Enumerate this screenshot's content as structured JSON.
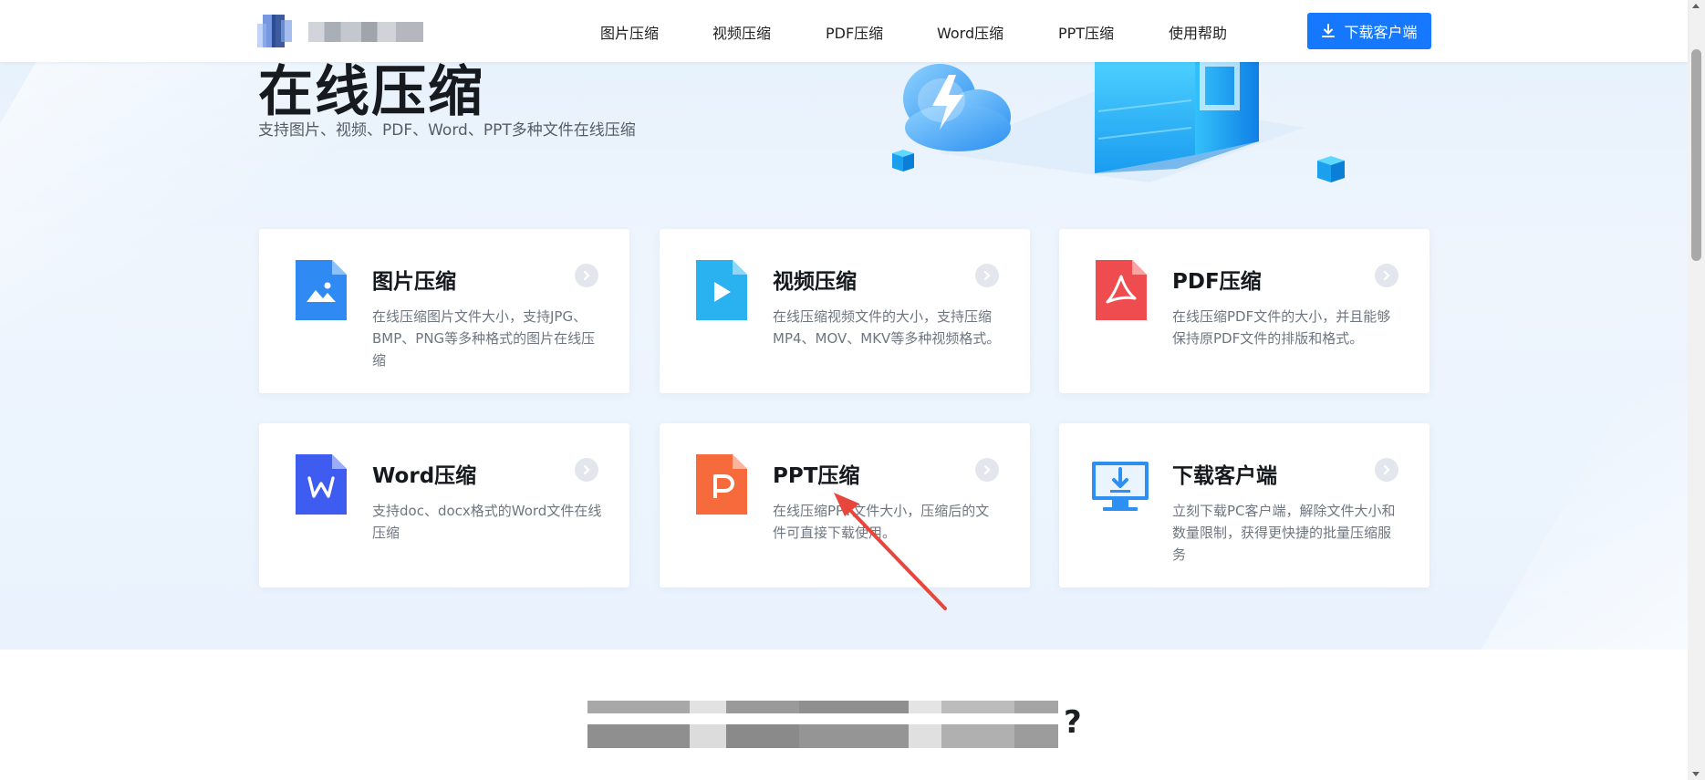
{
  "header": {
    "nav": [
      {
        "label": "图片压缩"
      },
      {
        "label": "视频压缩"
      },
      {
        "label": "PDF压缩"
      },
      {
        "label": "Word压缩"
      },
      {
        "label": "PPT压缩"
      },
      {
        "label": "使用帮助"
      }
    ],
    "download_button": "下载客户端"
  },
  "hero": {
    "title": "在线压缩",
    "subtitle": "支持图片、视频、PDF、Word、PPT多种文件在线压缩"
  },
  "cards": [
    {
      "title": "图片压缩",
      "desc": "在线压缩图片文件大小，支持JPG、BMP、PNG等多种格式的图片在线压缩",
      "icon": "image-file-icon",
      "color": "#2f8bf3"
    },
    {
      "title": "视频压缩",
      "desc": "在线压缩视频文件的大小，支持压缩MP4、MOV、MKV等多种视频格式。",
      "icon": "video-file-icon",
      "color": "#29b1f0"
    },
    {
      "title": "PDF压缩",
      "desc": "在线压缩PDF文件的大小，并且能够保持原PDF文件的排版和格式。",
      "icon": "pdf-file-icon",
      "color": "#ef4c50"
    },
    {
      "title": "Word压缩",
      "desc": "支持doc、docx格式的Word文件在线压缩",
      "icon": "word-file-icon",
      "color": "#3e5cf0"
    },
    {
      "title": "PPT压缩",
      "desc": "在线压缩PPT文件大小，压缩后的文件可直接下载使用。",
      "icon": "ppt-file-icon",
      "color": "#f76a3c"
    },
    {
      "title": "下载客户端",
      "desc": "立刻下载PC客户端，解除文件大小和数量限制，获得更快捷的批量压缩服务",
      "icon": "monitor-download-icon",
      "color": "#2c8ff1"
    }
  ],
  "section2": {
    "heading_suffix": "?"
  }
}
